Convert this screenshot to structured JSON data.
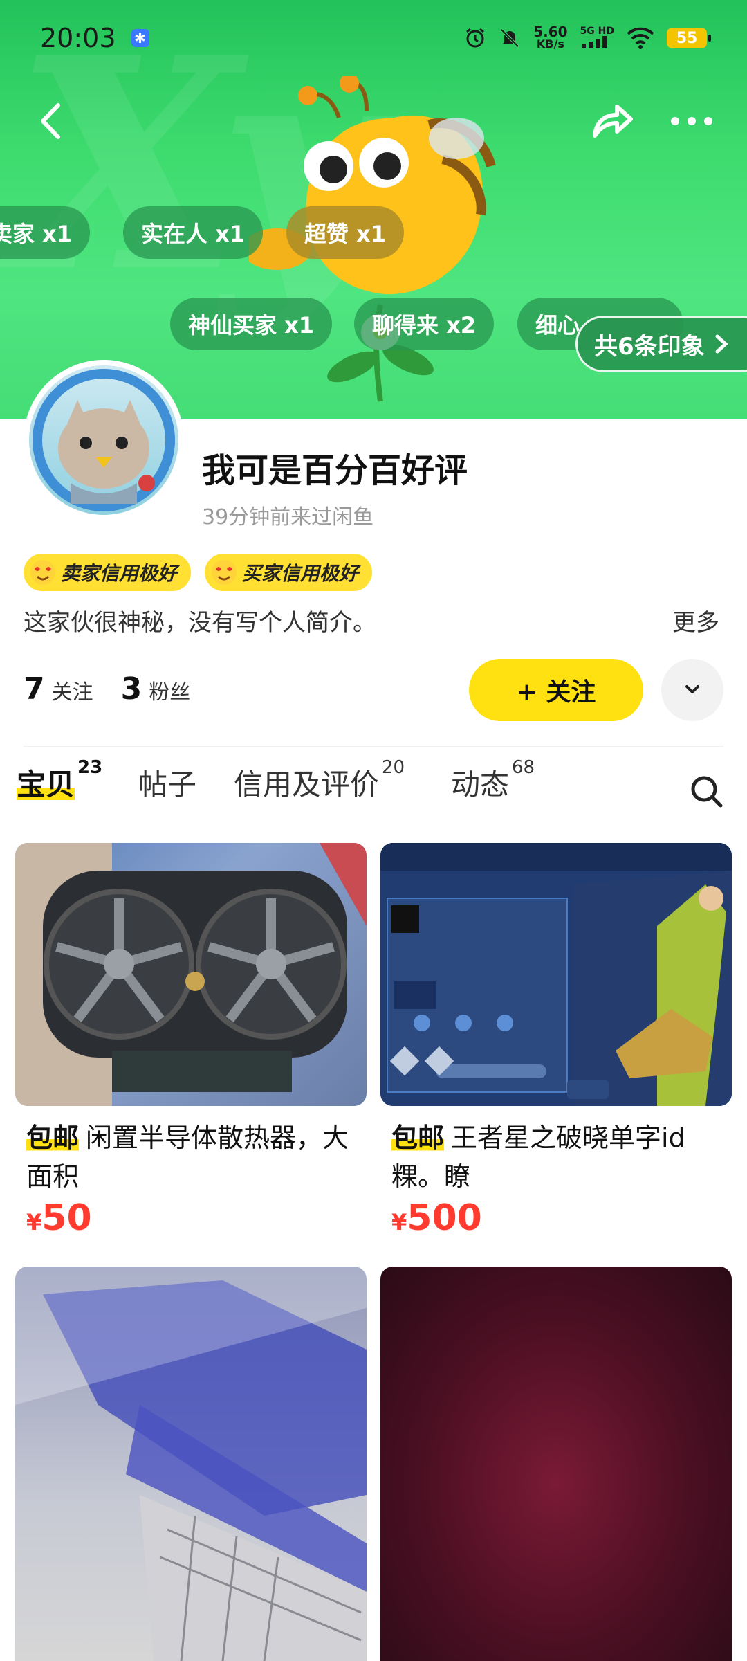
{
  "status_bar": {
    "time": "20:03",
    "network_speed_value": "5.60",
    "network_speed_unit": "KB/s",
    "network_type": "5G HD",
    "battery": "55"
  },
  "header": {
    "tags_row1": [
      "卖家 x1",
      "实在人 x1",
      "超赞 x1"
    ],
    "tags_row2": [
      "神仙买家 x1",
      "聊得来 x2",
      "细心"
    ],
    "impressions_label": "共6条印象"
  },
  "profile": {
    "username": "我可是百分百好评",
    "last_seen": "39分钟前来过闲鱼",
    "badges": [
      "卖家信用极好",
      "买家信用极好"
    ],
    "bio": "这家伙很神秘，没有写个人简介。",
    "more_label": "更多",
    "following_count": "7",
    "following_label": "关注",
    "followers_count": "3",
    "followers_label": "粉丝",
    "follow_button_label": "+ 关注"
  },
  "tabs": [
    {
      "label": "宝贝",
      "count": "23",
      "active": true
    },
    {
      "label": "帖子",
      "count": "",
      "active": false
    },
    {
      "label": "信用及评价",
      "count": "20",
      "active": false
    },
    {
      "label": "动态",
      "count": "68",
      "active": false
    }
  ],
  "products": [
    {
      "free_shipping": "包邮",
      "title": "闲置半导体散热器，大面积",
      "currency": "¥",
      "price": "50"
    },
    {
      "free_shipping": "包邮",
      "title": "王者星之破晓单字id 粿。瞭",
      "currency": "¥",
      "price": "500"
    }
  ],
  "colors": {
    "accent_yellow": "#ffe111",
    "banner_green": "#3ddb6e",
    "price_red": "#ff3b30"
  }
}
